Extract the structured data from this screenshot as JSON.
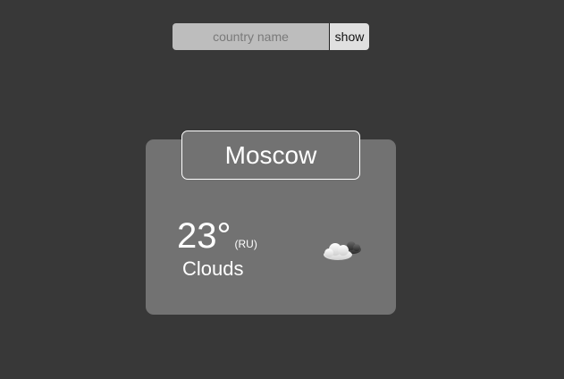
{
  "search": {
    "placeholder": "country name",
    "value": "",
    "button_label": "show"
  },
  "weather": {
    "city": "Moscow",
    "temperature": "23°",
    "country_code": "(RU)",
    "condition": "Clouds",
    "icon": "cloudy-icon"
  }
}
